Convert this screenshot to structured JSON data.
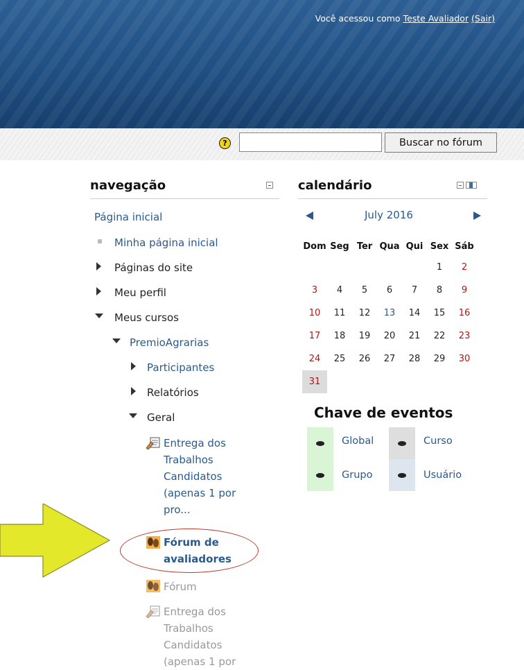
{
  "header": {
    "login_prefix": "Você acessou como",
    "user_name": "Teste Avaliador",
    "logout": "(Sair)"
  },
  "search": {
    "help_glyph": "?",
    "value": "",
    "placeholder": "",
    "button_label": "Buscar no fórum"
  },
  "navigation": {
    "title": "navegação",
    "items": [
      {
        "label": "Página inicial"
      },
      {
        "label": "Minha página inicial"
      },
      {
        "label": "Páginas do site"
      },
      {
        "label": "Meu perfil"
      },
      {
        "label": "Meus cursos"
      },
      {
        "label": "PremioAgrarias"
      },
      {
        "label": "Participantes"
      },
      {
        "label": "Relatórios"
      },
      {
        "label": "Geral"
      }
    ],
    "activities": [
      {
        "lines": [
          "Entrega dos",
          "Trabalhos",
          "Candidatos",
          "(apenas 1 por",
          "pro..."
        ],
        "icon": "assignment-icon"
      },
      {
        "lines": [
          "Fórum de",
          "avaliadores"
        ],
        "icon": "forum-icon"
      },
      {
        "lines": [
          "Fórum"
        ],
        "icon": "forum-icon"
      },
      {
        "lines": [
          "Entrega dos",
          "Trabalhos",
          "Candidatos",
          "(apenas 1 por"
        ],
        "icon": "assignment-icon"
      }
    ]
  },
  "calendar": {
    "title": "calendário",
    "month": "July 2016",
    "days_of_week": [
      "Dom",
      "Seg",
      "Ter",
      "Qua",
      "Qui",
      "Sex",
      "Sáb"
    ],
    "weeks": [
      [
        "",
        "",
        "",
        "",
        "",
        "1",
        "2"
      ],
      [
        "3",
        "4",
        "5",
        "6",
        "7",
        "8",
        "9"
      ],
      [
        "10",
        "11",
        "12",
        "13",
        "14",
        "15",
        "16"
      ],
      [
        "17",
        "18",
        "19",
        "20",
        "21",
        "22",
        "23"
      ],
      [
        "24",
        "25",
        "26",
        "27",
        "28",
        "29",
        "30"
      ],
      [
        "31",
        "",
        "",
        "",
        "",
        "",
        ""
      ]
    ],
    "today": "31",
    "event_day": "13",
    "events_title": "Chave de eventos",
    "events": [
      {
        "label": "Global",
        "color": "#d9f5d6"
      },
      {
        "label": "Curso",
        "color": "#dedede"
      },
      {
        "label": "Grupo",
        "color": "#d9f5d6"
      },
      {
        "label": "Usuário",
        "color": "#dde6ee"
      }
    ]
  },
  "colors": {
    "header": "#1f4f83",
    "link": "#2a5a8c",
    "weekend": "#b31515",
    "annotation_arrow": "#e3e82a",
    "annotation_oval": "#c0392b"
  }
}
